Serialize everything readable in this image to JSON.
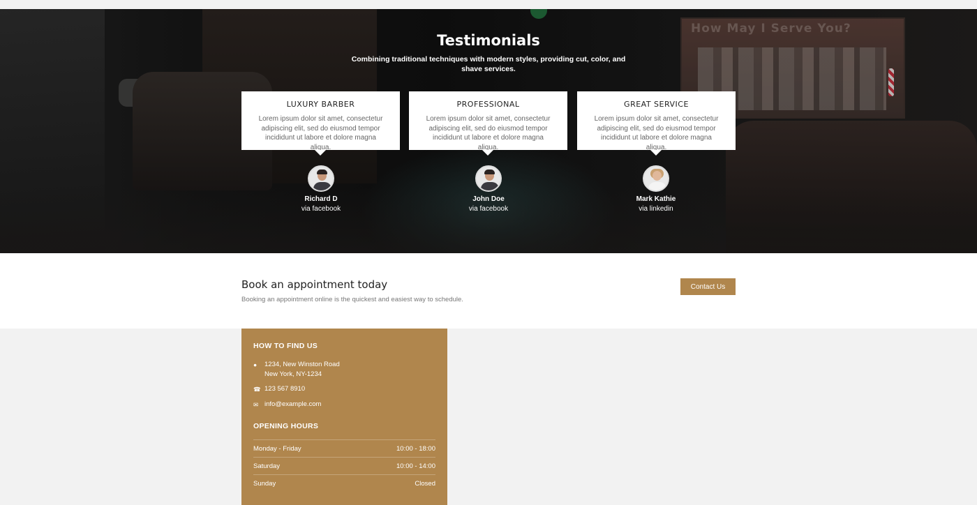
{
  "testimonials": {
    "title": "Testimonials",
    "subtitle": "Combining traditional techniques with modern styles, providing cut, color, and shave services.",
    "background_sign": "How May I Serve You?",
    "cards": [
      {
        "title": "LUXURY BARBER",
        "text": "Lorem ipsum dolor sit amet, consectetur adipiscing elit, sed do eiusmod tempor incididunt ut labore et dolore magna aliqua.",
        "name": "Richard D",
        "via": "via facebook"
      },
      {
        "title": "PROFESSIONAL",
        "text": "Lorem ipsum dolor sit amet, consectetur adipiscing elit, sed do eiusmod tempor incididunt ut labore et dolore magna aliqua.",
        "name": "John Doe",
        "via": "via facebook"
      },
      {
        "title": "GREAT SERVICE",
        "text": "Lorem ipsum dolor sit amet, consectetur adipiscing elit, sed do eiusmod tempor incididunt ut labore et dolore magna aliqua.",
        "name": "Mark Kathie",
        "via": "via linkedin"
      }
    ]
  },
  "appointment": {
    "title": "Book an appointment today",
    "text": "Booking an appointment online is the quickest and easiest way to schedule.",
    "button_label": "Contact Us"
  },
  "find_us": {
    "title": "HOW TO FIND US",
    "address_line1": "1234, New Winston Road",
    "address_line2": "New York, NY-1234",
    "phone": "123 567 8910",
    "email": "info@example.com",
    "icons": {
      "address": "map-marker-icon",
      "phone": "phone-icon",
      "email": "envelope-icon"
    }
  },
  "hours": {
    "title": "OPENING HOURS",
    "rows": [
      {
        "day": "Monday - Friday",
        "time": "10:00 - 18:00"
      },
      {
        "day": "Saturday",
        "time": "10:00 - 14:00"
      },
      {
        "day": "Sunday",
        "time": "Closed"
      }
    ]
  },
  "colors": {
    "accent": "#b0864d",
    "hero_bg": "#121212",
    "text_dark": "#222222"
  }
}
